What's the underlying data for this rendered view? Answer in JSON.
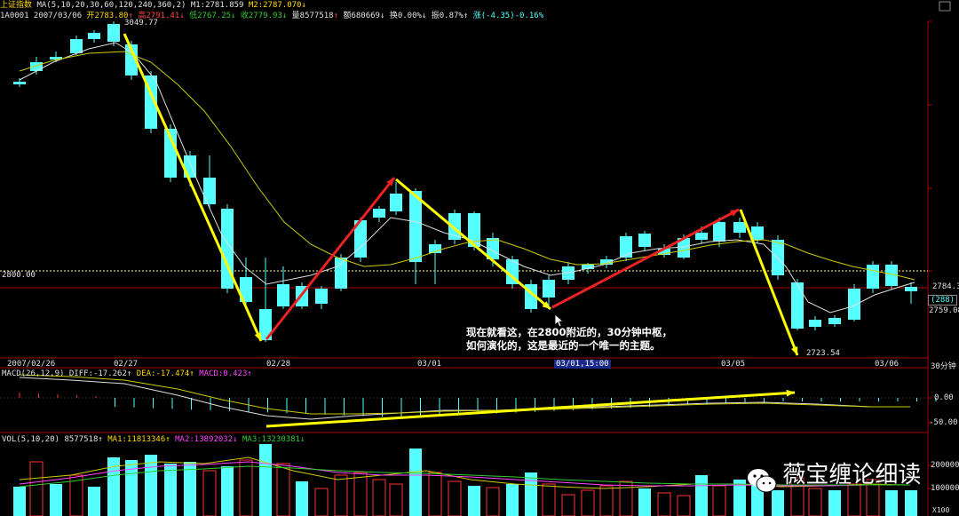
{
  "header": {
    "index_name": "上证指数",
    "ma_label": "MA(5,10,20,30,60,120,240,360,2)",
    "m1": "M1:2781.859",
    "m2": "M2:2787.070"
  },
  "info": {
    "code_date": "1A0001 2007/03/06",
    "open": "开2783.80",
    "high": "高2791.41",
    "low": "低2767.25",
    "close": "收2779.93",
    "volume": "量8577518",
    "amount": "额680669",
    "turnover": "换0.00%",
    "amplitude": "振0.87%",
    "change": "涨(-4.35)-0.16%"
  },
  "price_axis": {
    "high_mark": "3049.77",
    "low_mark": "2723.54",
    "ref_level": "2800.00",
    "right_last": "2784.3",
    "right_count": "(288)",
    "right_low": "2759.08"
  },
  "time_axis": {
    "labels": [
      "2007/02/26",
      "02/27",
      "02/28",
      "03/01",
      "03/01,15:00",
      "03/05",
      "03/06"
    ],
    "period": "30分钟"
  },
  "macd": {
    "label": "MACD(26,12,9)",
    "diff": "DIFF:-17.262",
    "dea": "DEA:-17.474",
    "macd": "MACD:0.423",
    "tick_zero": "0.00",
    "tick_neg": "-50.00"
  },
  "vol": {
    "label": "VOL(5,10,20)",
    "value": "8577518",
    "ma1": "MA1:11813346",
    "ma2": "MA2:13892032",
    "ma3": "MA3:13230381",
    "tick_200k": "200000",
    "tick_100k": "100000",
    "unit": "X100"
  },
  "annotation": {
    "line1": "现在就看这，在2800附近的，30分钟中枢，",
    "line2": "如何演化的，这是最近的一个唯一的主题。"
  },
  "watermark": "薇宝缠论细读",
  "colors": {
    "up": "#ff3333",
    "down": "#55ffff",
    "ma_white": "#dddddd",
    "ma_yellow": "#cccc00",
    "arrow_yellow": "#ffff00",
    "arrow_red": "#ee2222"
  }
}
